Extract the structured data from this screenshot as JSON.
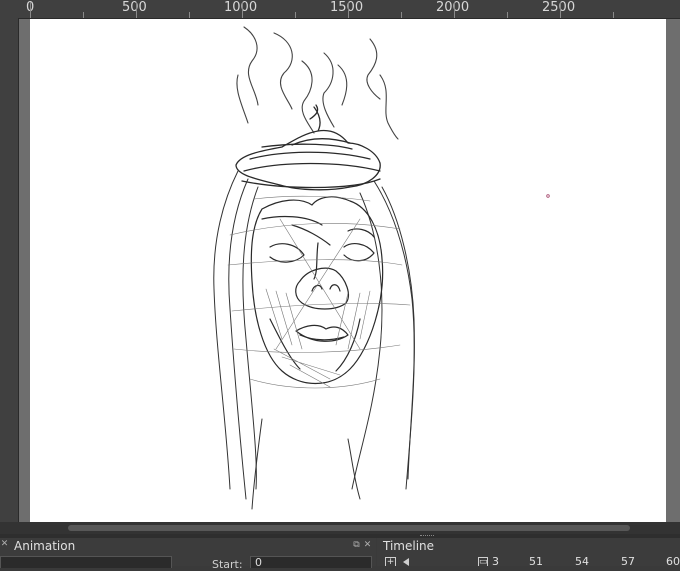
{
  "ruler": {
    "labels": [
      "0",
      "500",
      "1000",
      "1500",
      "2000",
      "2500"
    ]
  },
  "animation_docker": {
    "title": "Animation",
    "start_label": "Start:",
    "start_value": "0"
  },
  "timeline_docker": {
    "title": "Timeline",
    "frame_numbers": [
      "3",
      "51",
      "54",
      "57",
      "60"
    ]
  },
  "icons": {
    "float": "float-icon",
    "close": "close-icon"
  }
}
